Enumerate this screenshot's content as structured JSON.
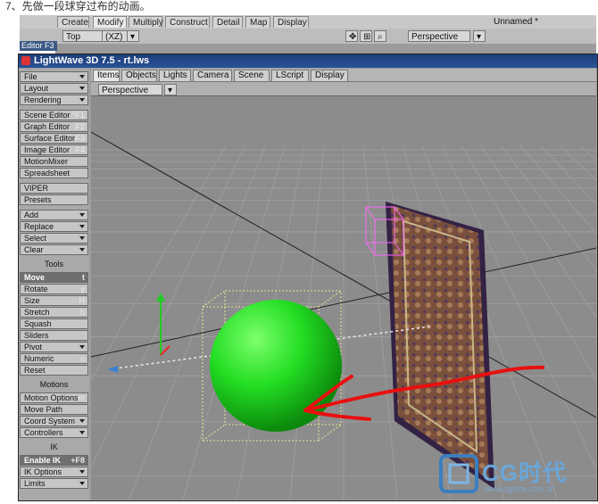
{
  "caption": "7、先做一段球穿过布的动画。",
  "back_window": {
    "tabs": [
      "Create",
      "Modify",
      "Multiply",
      "Construct",
      "Detail",
      "Map",
      "Display"
    ],
    "active_tab": "Modify",
    "title": "Unnamed *",
    "toolbar": {
      "view": "Top",
      "axis": "(XZ)",
      "perspective": "Perspective"
    },
    "editor_label": "Editor F3"
  },
  "window": {
    "title": "LightWave 3D 7.5 - rt.lws",
    "view_tabs": [
      "Items",
      "Objects",
      "Lights",
      "Camera",
      "Scene",
      "LScript",
      "Display"
    ],
    "active_view_tab": "Items",
    "viewport_mode": "Perspective"
  },
  "sidebar": {
    "items": [
      {
        "label": "File",
        "arrow": true
      },
      {
        "label": "Layout",
        "arrow": true
      },
      {
        "label": "Rendering",
        "arrow": true
      },
      {
        "label": "Scene Editor",
        "key": "^F1"
      },
      {
        "label": "Graph Editor",
        "key": "F2"
      },
      {
        "label": "Surface Editor",
        "key": "F3"
      },
      {
        "label": "Image Editor",
        "key": "F4"
      },
      {
        "label": "MotionMixer"
      },
      {
        "label": "Spreadsheet"
      },
      {
        "label": "VIPER"
      },
      {
        "label": "Presets"
      },
      {
        "label": "Add",
        "arrow": true
      },
      {
        "label": "Replace",
        "arrow": true
      },
      {
        "label": "Select",
        "arrow": true
      },
      {
        "label": "Clear",
        "arrow": true
      },
      {
        "label": "Tools",
        "header": true
      },
      {
        "label": "Move",
        "key": "t",
        "selected": true
      },
      {
        "label": "Rotate",
        "key": "y"
      },
      {
        "label": "Size",
        "key": "H"
      },
      {
        "label": "Stretch",
        "key": "h"
      },
      {
        "label": "Squash"
      },
      {
        "label": "Sliders"
      },
      {
        "label": "Pivot",
        "arrow": true
      },
      {
        "label": "Numeric",
        "key": "n"
      },
      {
        "label": "Reset"
      },
      {
        "label": "Motions",
        "header": true
      },
      {
        "label": "Motion Options",
        "key": "m"
      },
      {
        "label": "Move Path"
      },
      {
        "label": "Coord System",
        "arrow": true
      },
      {
        "label": "Controllers",
        "arrow": true
      },
      {
        "label": "IK",
        "header": true
      },
      {
        "label": "Enable IK",
        "key": "+F8",
        "selected": true
      },
      {
        "label": "IK Options",
        "arrow": true
      },
      {
        "label": "Limits",
        "arrow": true
      }
    ]
  },
  "watermark": {
    "text": "CG时代",
    "url": "www.cgtime.com.cn"
  },
  "colors": {
    "sphere": "#22dd22",
    "arrow": "#e81010",
    "titlebar": "#1e3e78"
  }
}
